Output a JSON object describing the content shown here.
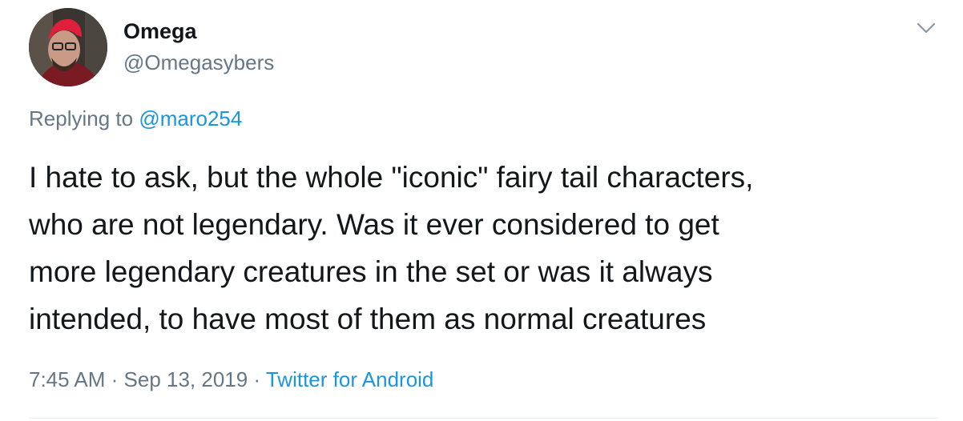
{
  "tweet": {
    "author": {
      "display_name": "Omega",
      "handle": "@Omegasybers"
    },
    "replying_to": {
      "prefix": "Replying to",
      "mention": "@maro254"
    },
    "text_lines": [
      "I hate to ask, but the whole \"iconic\" fairy tail characters,",
      "who are not legendary. Was it ever considered to get",
      "more legendary creatures in the set or was it always",
      "intended, to have most of them as normal creatures"
    ],
    "meta": {
      "time": "7:45 AM",
      "separator1": " · ",
      "date": "Sep 13, 2019",
      "separator2": " · ",
      "source": "Twitter for Android"
    },
    "icons": {
      "menu": "chevron-down-icon"
    },
    "colors": {
      "link": "#1b95e0",
      "secondary_text": "#657786",
      "primary_text": "#14171a",
      "divider": "#e6ecf0"
    }
  }
}
